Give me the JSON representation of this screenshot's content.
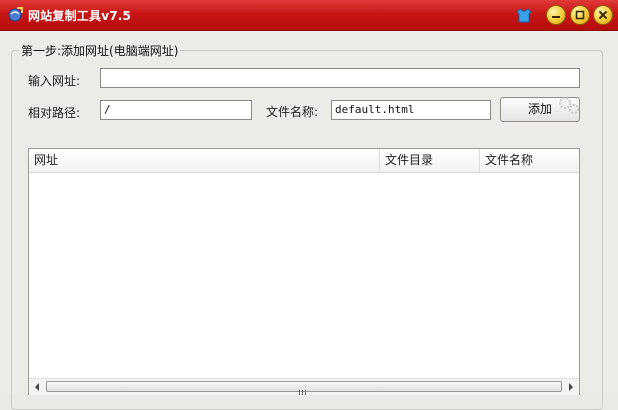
{
  "window": {
    "title": "网站复制工具v7.5",
    "accent": "#c81616",
    "controls": [
      "skin-icon",
      "minimize-icon",
      "maximize-icon",
      "close-icon"
    ]
  },
  "step1": {
    "legend": "第一步:添加网址(电脑端网址)",
    "url_label": "输入网址:",
    "url_value": "",
    "path_label": "相对路径:",
    "path_value": "/",
    "filename_label": "文件名称:",
    "filename_value": "default.html",
    "add_button": "添加"
  },
  "list": {
    "columns": [
      "网址",
      "文件目录",
      "文件名称"
    ],
    "rows": []
  }
}
